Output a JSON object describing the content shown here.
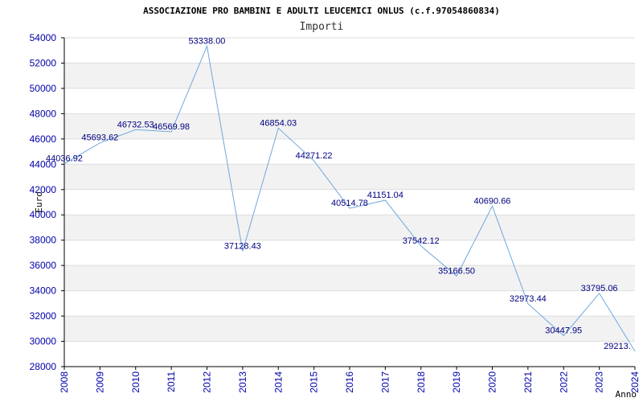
{
  "chart_data": {
    "type": "line",
    "title": "ASSOCIAZIONE PRO BAMBINI E ADULTI LEUCEMICI ONLUS (c.f.97054860834)",
    "subtitle": "Importi",
    "xlabel": "Anno",
    "ylabel": "Euro",
    "x": [
      2008,
      2009,
      2010,
      2011,
      2012,
      2013,
      2014,
      2015,
      2016,
      2017,
      2018,
      2019,
      2020,
      2021,
      2022,
      2023,
      2024
    ],
    "values": [
      44036.92,
      45693.62,
      46732.53,
      46569.98,
      53338.0,
      37128.43,
      46854.03,
      44271.22,
      40514.78,
      41151.04,
      37542.12,
      35166.5,
      40690.66,
      32973.44,
      30447.95,
      33795.06,
      29213.62
    ],
    "labels": [
      "44036.92",
      "45693.62",
      "46732.53",
      "46569.98",
      "53338.00",
      "37128.43",
      "46854.03",
      "44271.22",
      "40514.78",
      "41151.04",
      "37542.12",
      "35166.50",
      "40690.66",
      "32973.44",
      "30447.95",
      "33795.06",
      "29213."
    ],
    "ylim": [
      28000,
      54000
    ],
    "yticks": [
      28000,
      30000,
      32000,
      34000,
      36000,
      38000,
      40000,
      42000,
      44000,
      46000,
      48000,
      50000,
      52000,
      54000
    ],
    "grid": true,
    "colors": {
      "line": "#6fa8dc",
      "band": "#f2f2f2",
      "grid": "#dddddd",
      "axis": "#000000"
    }
  }
}
